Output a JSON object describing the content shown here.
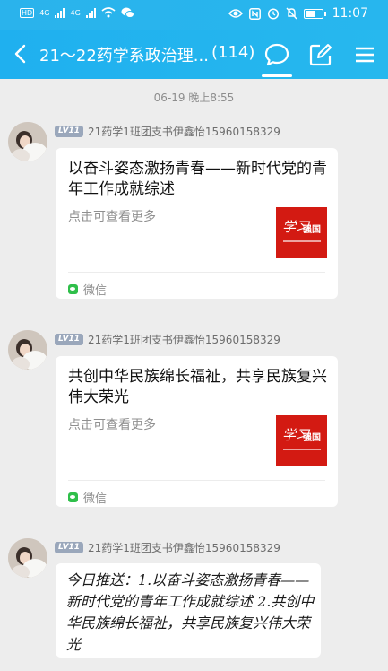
{
  "status_bar": {
    "left_text": "HD",
    "network_1": "4G",
    "network_2": "4G",
    "time": "11:07"
  },
  "header": {
    "title": "21～22药学系政治理...",
    "member_count": "(114)",
    "icons": [
      "back-icon",
      "chat-icon",
      "edit-icon",
      "menu-icon"
    ]
  },
  "chat": {
    "timestamp": "06-19 晚上8:55",
    "messages": [
      {
        "level": "LV11",
        "sender": "21药学1班团支书伊鑫怡15960158329",
        "title": "以奋斗姿态激扬青春——新时代党的青年工作成就综述",
        "desc": "点击可查看更多",
        "source": "微信",
        "thumb_brand": "强国",
        "thumb_script": "学习"
      },
      {
        "level": "LV11",
        "sender": "21药学1班团支书伊鑫怡15960158329",
        "title": "共创中华民族绵长福祉，共享民族复兴伟大荣光",
        "desc": "点击可查看更多",
        "source": "微信",
        "thumb_brand": "强国",
        "thumb_script": "学习"
      },
      {
        "level": "LV11",
        "sender": "21药学1班团支书伊鑫怡15960158329",
        "text": "今日推送：1.以奋斗姿态激扬青春——新时代党的青年工作成就综述 2.共创中华民族绵长福祉，共享民族复兴伟大荣光"
      }
    ]
  },
  "colors": {
    "header": "#22b3ee",
    "thumb_red": "#d31a12",
    "wechat_green": "#2fbf4a"
  }
}
